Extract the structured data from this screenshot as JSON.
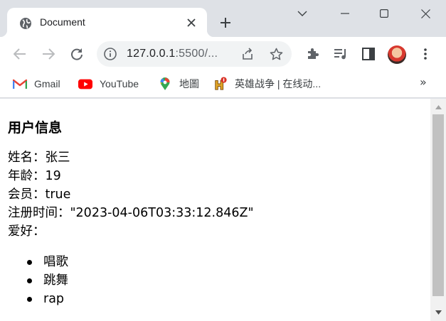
{
  "browser": {
    "tab": {
      "title": "Document"
    },
    "omnibox": {
      "url_host": "127.0.0.1",
      "url_rest": ":5500/..."
    },
    "bookmarks": [
      {
        "label": "Gmail",
        "icon": "gmail-icon"
      },
      {
        "label": "YouTube",
        "icon": "youtube-icon"
      },
      {
        "label": "地圖",
        "icon": "maps-icon"
      },
      {
        "label": "英雄战争 | 在线动...",
        "icon": "game-icon"
      }
    ],
    "bookmarks_more": "»",
    "colors": {
      "chrome_bg": "#dee1e6",
      "omnibox_bg": "#f1f3f4",
      "youtube_red": "#ff0000"
    }
  },
  "page": {
    "heading": "用户信息",
    "fields": [
      {
        "label": "姓名：",
        "value": "张三"
      },
      {
        "label": "年龄：",
        "value": "19"
      },
      {
        "label": "会员：",
        "value": "true"
      },
      {
        "label": "注册时间：",
        "value": "\"2023-04-06T03:33:12.846Z\""
      },
      {
        "label": "爱好：",
        "value": ""
      }
    ],
    "hobbies": [
      "唱歌",
      "跳舞",
      "rap"
    ]
  }
}
